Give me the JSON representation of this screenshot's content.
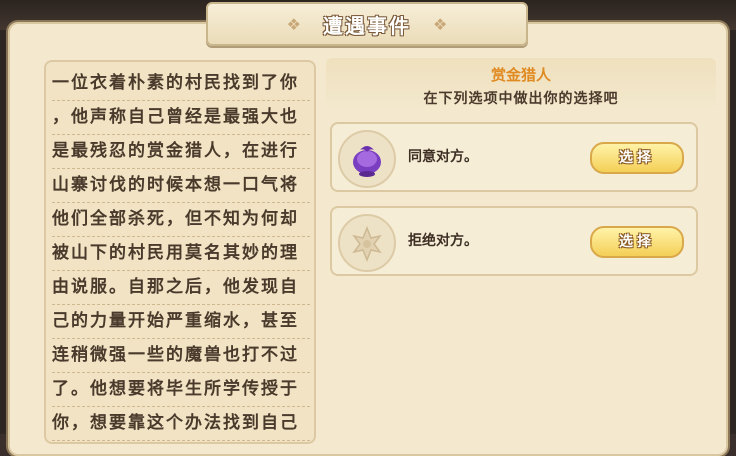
{
  "dialog": {
    "title": "遭遇事件"
  },
  "story": {
    "lines": [
      "一位衣着朴素的村民找到了你",
      "，他声称自己曾经是最强大也",
      "是最残忍的赏金猎人，在进行",
      "山寨讨伐的时候本想一口气将",
      "他们全部杀死，但不知为何却",
      "被山下的村民用莫名其妙的理",
      "由说服。自那之后，他发现自",
      "己的力量开始严重缩水，甚至",
      "连稍微强一些的魔兽也打不过",
      "了。他想要将毕生所学传授于",
      "你，想要靠这个办法找到自己"
    ]
  },
  "event": {
    "name": "赏金猎人",
    "prompt": "在下列选项中做出你的选择吧"
  },
  "options": [
    {
      "text": "同意对方。",
      "button": "选择",
      "icon": "purple-orb-icon"
    },
    {
      "text": "拒绝对方。",
      "button": "选择",
      "icon": "emblem-icon"
    }
  ],
  "colors": {
    "accent": "#e08a22",
    "button": "#f4cf57",
    "panel": "#f4e9cf"
  }
}
